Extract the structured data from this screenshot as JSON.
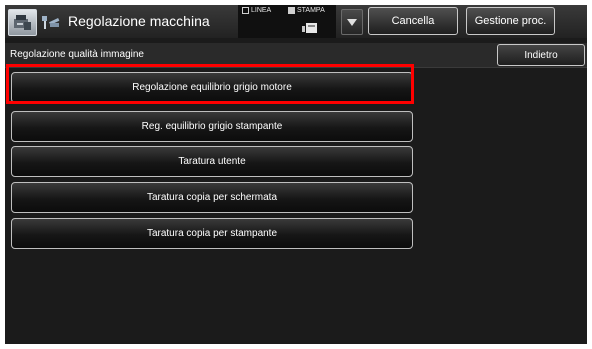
{
  "header": {
    "title": "Regolazione macchina",
    "status": {
      "line_label": "LINEA",
      "print_label": "STAMPA",
      "line_checked": false,
      "print_checked": true
    },
    "cancel_label": "Cancella",
    "job_status_label": "Gestione proc."
  },
  "subheader": {
    "title": "Regolazione qualità immagine",
    "back_label": "Indietro"
  },
  "menu": {
    "items": [
      {
        "label": "Regolazione equilibrio grigio motore",
        "highlighted": true
      },
      {
        "label": "Reg. equilibrio grigio stampante",
        "highlighted": false
      },
      {
        "label": "Taratura utente",
        "highlighted": false
      },
      {
        "label": "Taratura copia per schermata",
        "highlighted": false
      },
      {
        "label": "Taratura copia per stampante",
        "highlighted": false
      }
    ]
  },
  "colors": {
    "highlight": "#ff0000",
    "background": "#1b1b1b"
  },
  "icons": [
    "machine-logo-icon",
    "adjust-tools-icon",
    "printer-icon",
    "chevron-down-icon"
  ]
}
